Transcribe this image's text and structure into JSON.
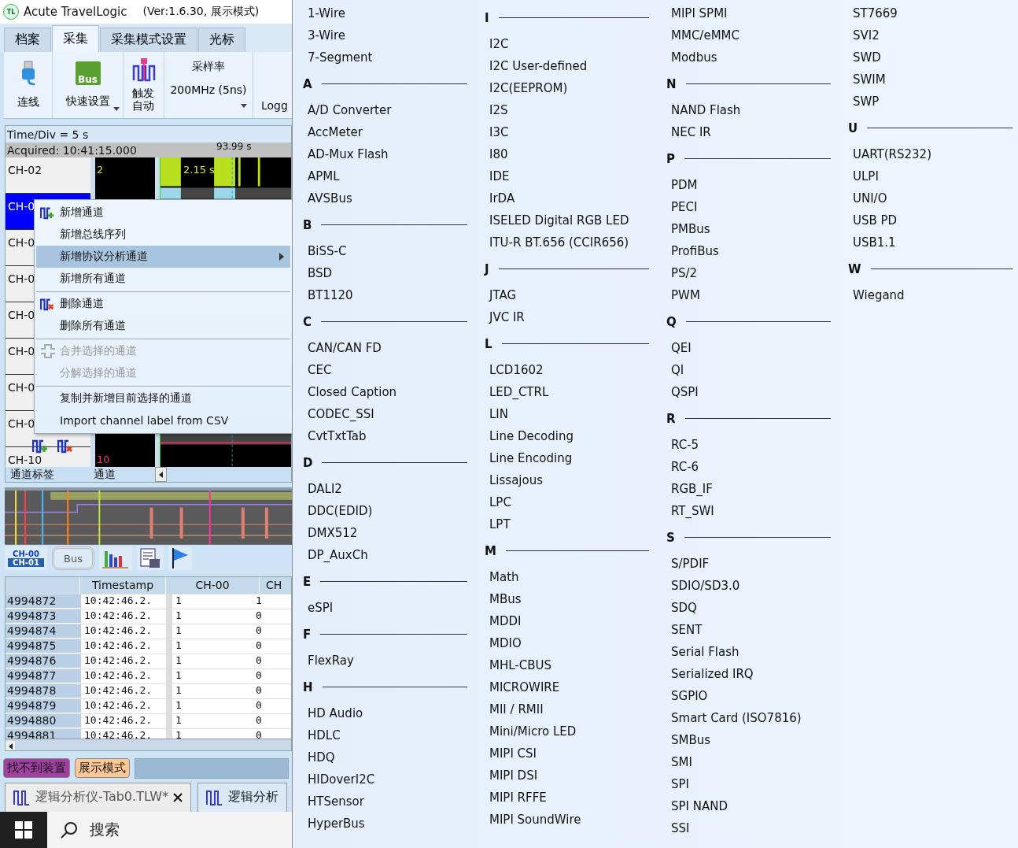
{
  "app": {
    "title": "Acute TravelLogic",
    "subtitle": "(Ver:1.6.30, 展示模式)",
    "logo": "TL"
  },
  "ribbon_tabs": [
    {
      "label": "档案",
      "selected": false
    },
    {
      "label": "采集",
      "selected": true
    },
    {
      "label": "采集模式设置",
      "selected": false
    },
    {
      "label": "光标",
      "selected": false
    }
  ],
  "ribbon": {
    "buttons": [
      {
        "label": "连线",
        "kind": "usb",
        "dropdown": false
      },
      {
        "label": "快速设置",
        "kind": "bus",
        "icon_text": "Bus",
        "dropdown": true
      },
      {
        "label": "触发自动",
        "kind": "trigger",
        "dropdown": false
      }
    ],
    "sample_rate": {
      "label": "采样率",
      "value": "200MHz (5ns)"
    },
    "cut_label": "Logg"
  },
  "waveform": {
    "time_div": "Time/Div = 5 s",
    "acquired": "Acquired: 10:41:15.000",
    "cursor_time": "93.99 s",
    "measure": "2.15 s",
    "channels": [
      {
        "label": "CH-02",
        "selected": false,
        "value": "2"
      },
      {
        "label": "CH-0",
        "selected": true
      },
      {
        "label": "CH-0",
        "selected": false
      },
      {
        "label": "CH-0",
        "selected": false
      },
      {
        "label": "CH-0",
        "selected": false
      },
      {
        "label": "CH-0",
        "selected": false
      },
      {
        "label": "CH-0",
        "selected": false
      },
      {
        "label": "CH-0",
        "selected": false
      },
      {
        "label": "CH-10",
        "selected": false,
        "value": "10"
      }
    ],
    "footer": [
      "通道标签",
      "通道"
    ]
  },
  "context_menu": [
    {
      "label": "新增通道",
      "kind": "add",
      "selected": false,
      "disabled": false,
      "submenu": false,
      "separator_before": false
    },
    {
      "label": "新增总线序列",
      "kind": "plain",
      "selected": false,
      "disabled": false,
      "submenu": false,
      "separator_before": false
    },
    {
      "label": "新增协议分析通道",
      "kind": "plain",
      "selected": true,
      "disabled": false,
      "submenu": true,
      "separator_before": false
    },
    {
      "label": "新增所有通道",
      "kind": "plain",
      "selected": false,
      "disabled": false,
      "submenu": false,
      "separator_before": false
    },
    {
      "label": "删除通道",
      "kind": "delete",
      "selected": false,
      "disabled": false,
      "submenu": false,
      "separator_before": true
    },
    {
      "label": "删除所有通道",
      "kind": "plain",
      "selected": false,
      "disabled": false,
      "submenu": false,
      "separator_before": false
    },
    {
      "label": "合并选择的通道",
      "kind": "merge",
      "selected": false,
      "disabled": true,
      "submenu": false,
      "separator_before": true
    },
    {
      "label": "分解选择的通道",
      "kind": "plain",
      "selected": false,
      "disabled": true,
      "submenu": false,
      "separator_before": false
    },
    {
      "label": "复制并新增目前选择的通道",
      "kind": "plain",
      "selected": false,
      "disabled": false,
      "submenu": false,
      "separator_before": true
    },
    {
      "label": "Import channel label from CSV",
      "kind": "plain",
      "selected": false,
      "disabled": false,
      "submenu": false,
      "separator_before": false
    }
  ],
  "toolbar": {
    "channel_labels": [
      "CH-00",
      "CH-01"
    ],
    "bus_label": "Bus"
  },
  "table": {
    "columns": [
      "Timestamp",
      "CH-00",
      "CH"
    ],
    "rows": [
      {
        "index": "4994872",
        "timestamp": "10:42:46.2.",
        "ch00": "1",
        "ch01": "1"
      },
      {
        "index": "4994873",
        "timestamp": "10:42:46.2.",
        "ch00": "1",
        "ch01": "0"
      },
      {
        "index": "4994874",
        "timestamp": "10:42:46.2.",
        "ch00": "1",
        "ch01": "0"
      },
      {
        "index": "4994875",
        "timestamp": "10:42:46.2.",
        "ch00": "1",
        "ch01": "0"
      },
      {
        "index": "4994876",
        "timestamp": "10:42:46.2.",
        "ch00": "1",
        "ch01": "0"
      },
      {
        "index": "4994877",
        "timestamp": "10:42:46.2.",
        "ch00": "1",
        "ch01": "0"
      },
      {
        "index": "4994878",
        "timestamp": "10:42:46.2.",
        "ch00": "1",
        "ch01": "0"
      },
      {
        "index": "4994879",
        "timestamp": "10:42:46.2.",
        "ch00": "1",
        "ch01": "0"
      },
      {
        "index": "4994880",
        "timestamp": "10:42:46.2.",
        "ch00": "1",
        "ch01": "0"
      },
      {
        "index": "4994881",
        "timestamp": "10:42:46.2.",
        "ch00": "1",
        "ch01": "0"
      }
    ]
  },
  "status_badges": [
    {
      "label": "找不到装置",
      "color": "#a040a0"
    },
    {
      "label": "展示模式",
      "color": "#fcc898"
    }
  ],
  "document_tabs": [
    {
      "label": "逻辑分析仪-Tab0.TLW*",
      "selected": true,
      "closable": true
    },
    {
      "label": "逻辑分析",
      "selected": false,
      "closable": false
    }
  ],
  "taskbar": {
    "search": "搜索"
  },
  "protocol_menu": [
    [
      {
        "items": [
          "1-Wire",
          "3-Wire",
          "7-Segment"
        ]
      },
      {
        "letter": "A",
        "items": [
          "A/D Converter",
          "AccMeter",
          "AD-Mux Flash",
          "APML",
          "AVSBus"
        ]
      },
      {
        "letter": "B",
        "items": [
          "BiSS-C",
          "BSD",
          "BT1120"
        ]
      },
      {
        "letter": "C",
        "items": [
          "CAN/CAN FD",
          "CEC",
          "Closed Caption",
          "CODEC_SSI",
          "CvtTxtTab"
        ]
      },
      {
        "letter": "D",
        "items": [
          "DALI2",
          "DDC(EDID)",
          "DMX512",
          "DP_AuxCh"
        ]
      },
      {
        "letter": "E",
        "items": [
          "eSPI"
        ]
      },
      {
        "letter": "F",
        "items": [
          "FlexRay"
        ]
      },
      {
        "letter": "H",
        "items": [
          "HD Audio",
          "HDLC",
          "HDQ",
          "HIDoverI2C",
          "HTSensor",
          "HyperBus"
        ]
      }
    ],
    [
      {
        "letter": "I",
        "items": [
          "I2C",
          "I2C User-defined",
          "I2C(EEPROM)",
          "I2S",
          "I3C",
          "I80",
          "IDE",
          "IrDA",
          "ISELED Digital RGB LED",
          "ITU-R BT.656 (CCIR656)"
        ]
      },
      {
        "letter": "J",
        "items": [
          "JTAG",
          "JVC IR"
        ]
      },
      {
        "letter": "L",
        "items": [
          "LCD1602",
          "LED_CTRL",
          "LIN",
          "Line Decoding",
          "Line Encoding",
          "Lissajous",
          "LPC",
          "LPT"
        ]
      },
      {
        "letter": "M",
        "items": [
          "Math",
          "MBus",
          "MDDI",
          "MDIO",
          "MHL-CBUS",
          "MICROWIRE",
          "MII / RMII",
          "Mini/Micro LED",
          "MIPI CSI",
          "MIPI DSI",
          "MIPI RFFE",
          "MIPI SoundWire"
        ]
      }
    ],
    [
      {
        "items": [
          "MIPI SPMI",
          "MMC/eMMC",
          "Modbus"
        ]
      },
      {
        "letter": "N",
        "items": [
          "NAND Flash",
          "NEC IR"
        ]
      },
      {
        "letter": "P",
        "items": [
          "PDM",
          "PECI",
          "PMBus",
          "ProfiBus",
          "PS/2",
          "PWM"
        ]
      },
      {
        "letter": "Q",
        "items": [
          "QEI",
          "QI",
          "QSPI"
        ]
      },
      {
        "letter": "R",
        "items": [
          "RC-5",
          "RC-6",
          "RGB_IF",
          "RT_SWI"
        ]
      },
      {
        "letter": "S",
        "items": [
          "S/PDIF",
          "SDIO/SD3.0",
          "SDQ",
          "SENT",
          "Serial Flash",
          "Serialized IRQ",
          "SGPIO",
          "Smart Card (ISO7816)",
          "SMBus",
          "SMI",
          "SPI",
          "SPI NAND",
          "SSI"
        ]
      }
    ],
    [
      {
        "items": [
          "ST7669",
          "SVI2",
          "SWD",
          "SWIM",
          "SWP"
        ]
      },
      {
        "letter": "U",
        "items": [
          "UART(RS232)",
          "ULPI",
          "UNI/O",
          "USB PD",
          "USB1.1"
        ]
      },
      {
        "letter": "W",
        "items": [
          "Wiegand"
        ]
      }
    ]
  ]
}
